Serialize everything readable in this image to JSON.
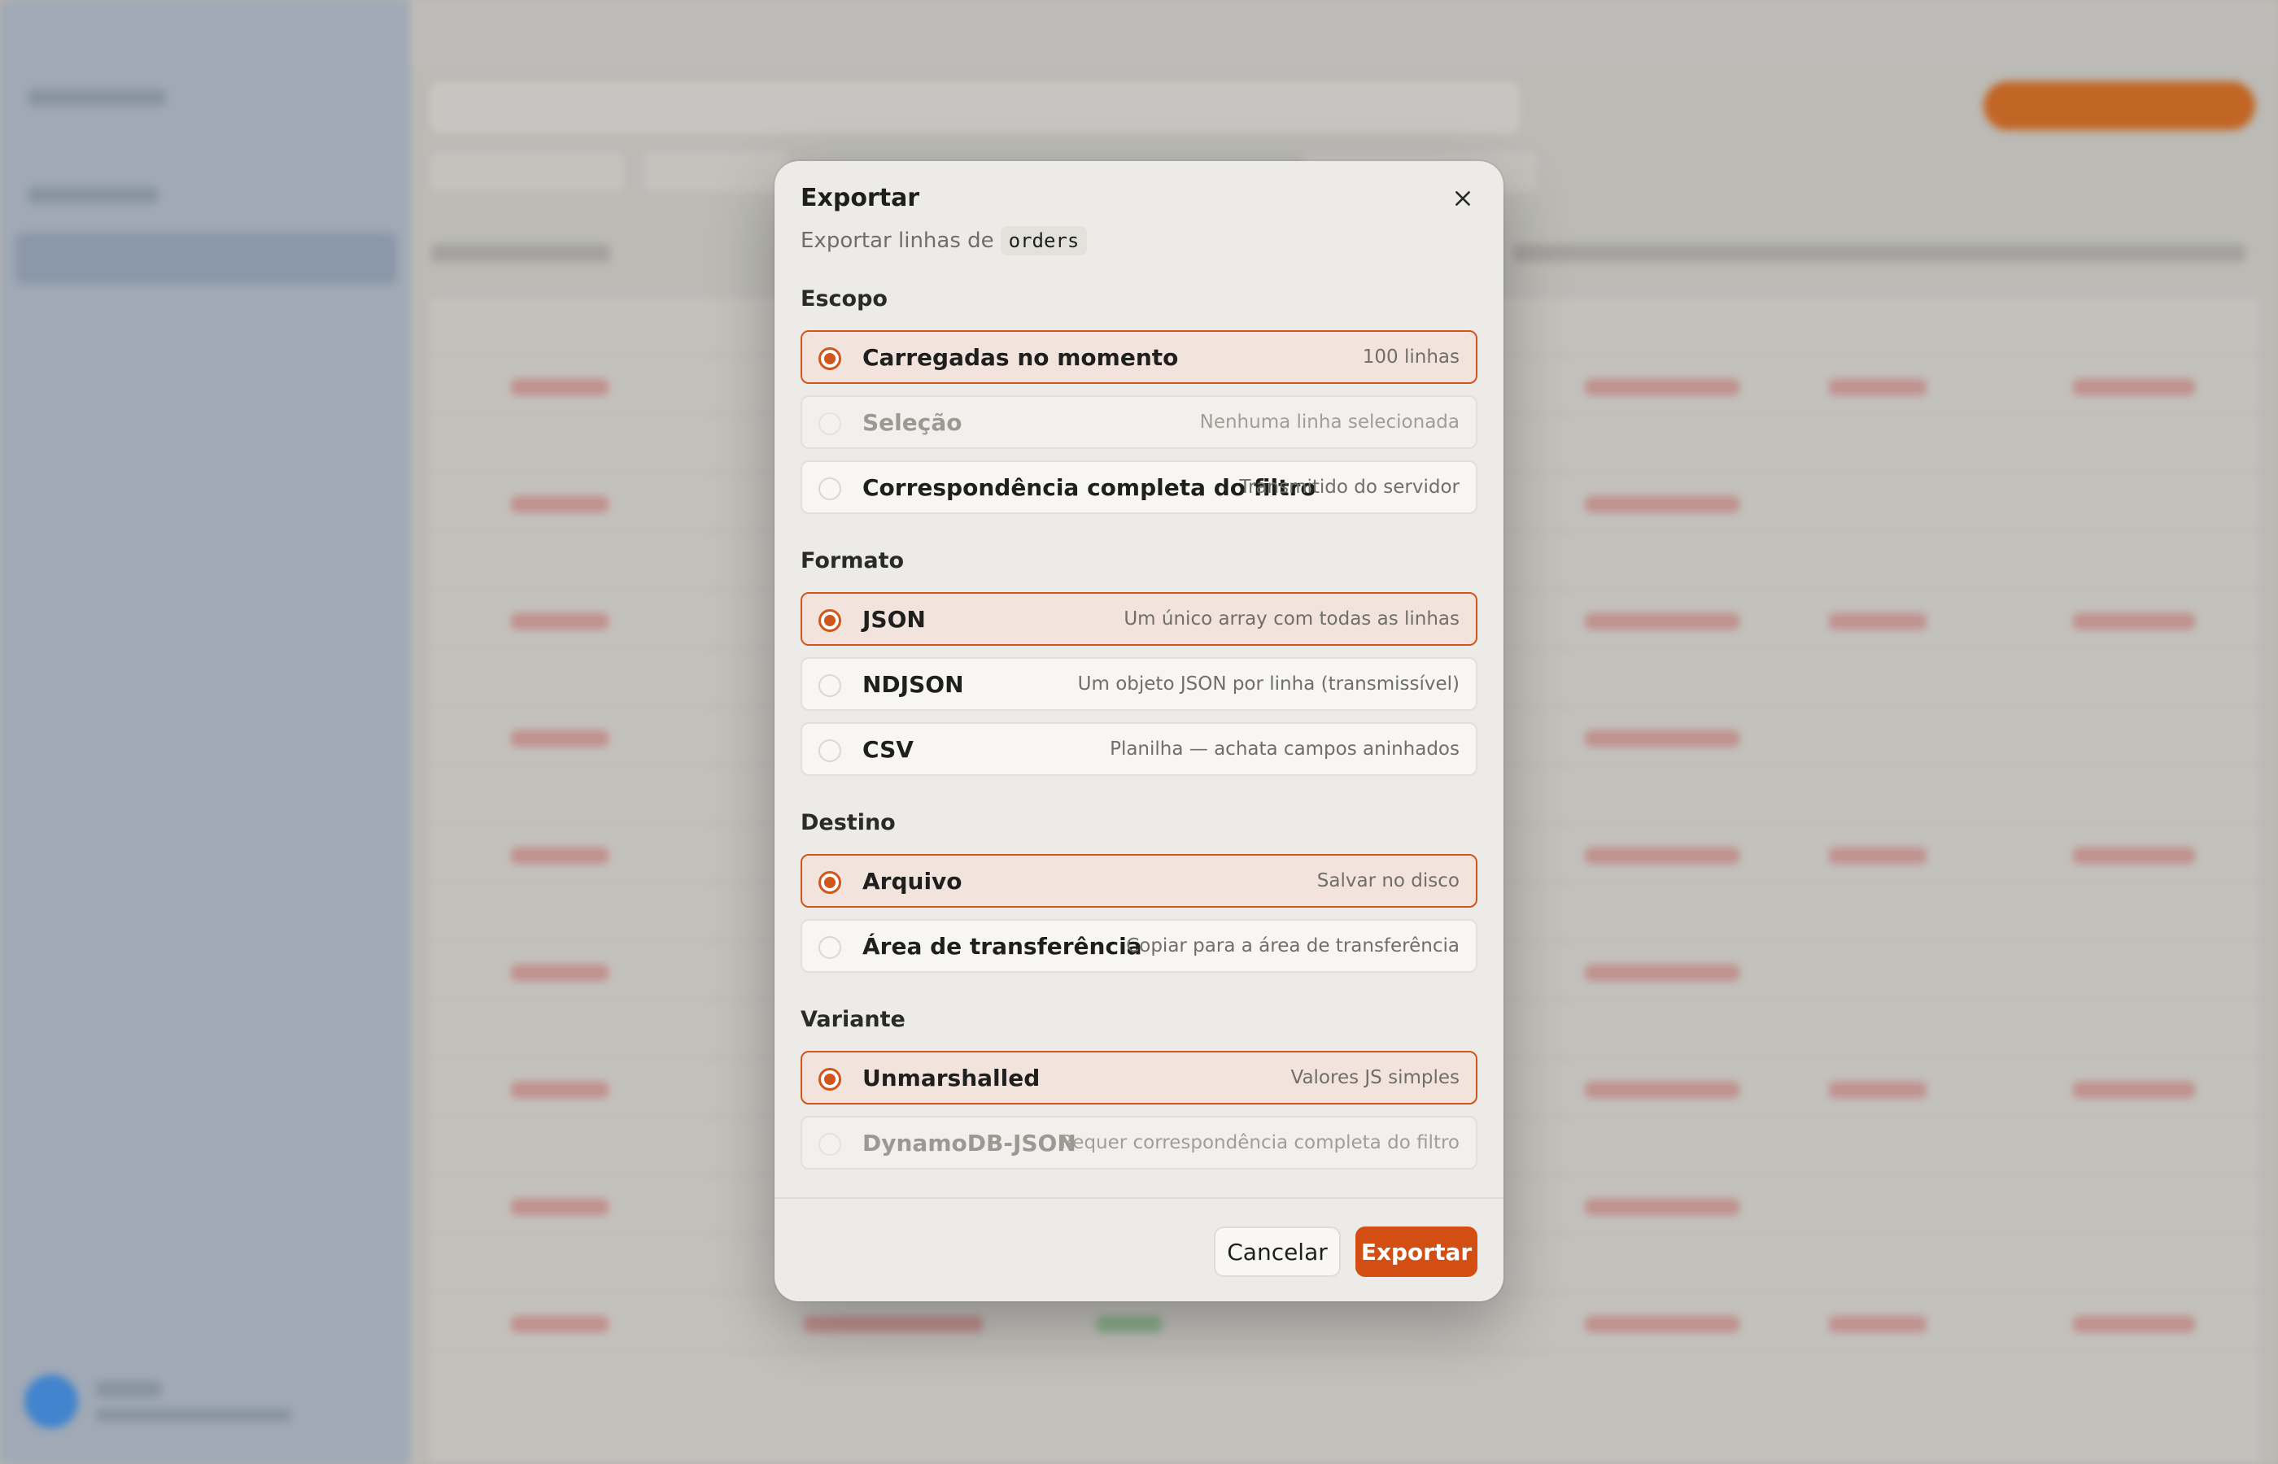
{
  "modal": {
    "title": "Exportar",
    "subtitle_prefix": "Exportar linhas de",
    "table_name": "orders",
    "scope": {
      "label": "Escopo",
      "options": [
        {
          "label": "Carregadas no momento",
          "desc": "100 linhas",
          "state": "selected"
        },
        {
          "label": "Seleção",
          "desc": "Nenhuma linha selecionada",
          "state": "disabled"
        },
        {
          "label": "Correspondência completa do filtro",
          "desc": "Transmitido do servidor",
          "state": "default"
        }
      ]
    },
    "format": {
      "label": "Formato",
      "options": [
        {
          "label": "JSON",
          "desc": "Um único array com todas as linhas",
          "state": "selected"
        },
        {
          "label": "NDJSON",
          "desc": "Um objeto JSON por linha (transmissível)",
          "state": "default"
        },
        {
          "label": "CSV",
          "desc": "Planilha — achata campos aninhados",
          "state": "default"
        }
      ]
    },
    "destination": {
      "label": "Destino",
      "options": [
        {
          "label": "Arquivo",
          "desc": "Salvar no disco",
          "state": "selected"
        },
        {
          "label": "Área de transferência",
          "desc": "Copiar para a área de transferência",
          "state": "default"
        }
      ]
    },
    "variant": {
      "label": "Variante",
      "options": [
        {
          "label": "Unmarshalled",
          "desc": "Valores JS simples",
          "state": "selected"
        },
        {
          "label": "DynamoDB-JSON",
          "desc": "Requer correspondência completa do filtro",
          "state": "disabled"
        }
      ]
    },
    "cancel_label": "Cancelar",
    "export_label": "Exportar"
  },
  "colors": {
    "accent": "#d24e12",
    "selected_border": "#d0561c",
    "selected_bg": "#f2e4dc",
    "modal_bg": "#ecebe7"
  },
  "icons": {
    "close": "close-icon"
  }
}
